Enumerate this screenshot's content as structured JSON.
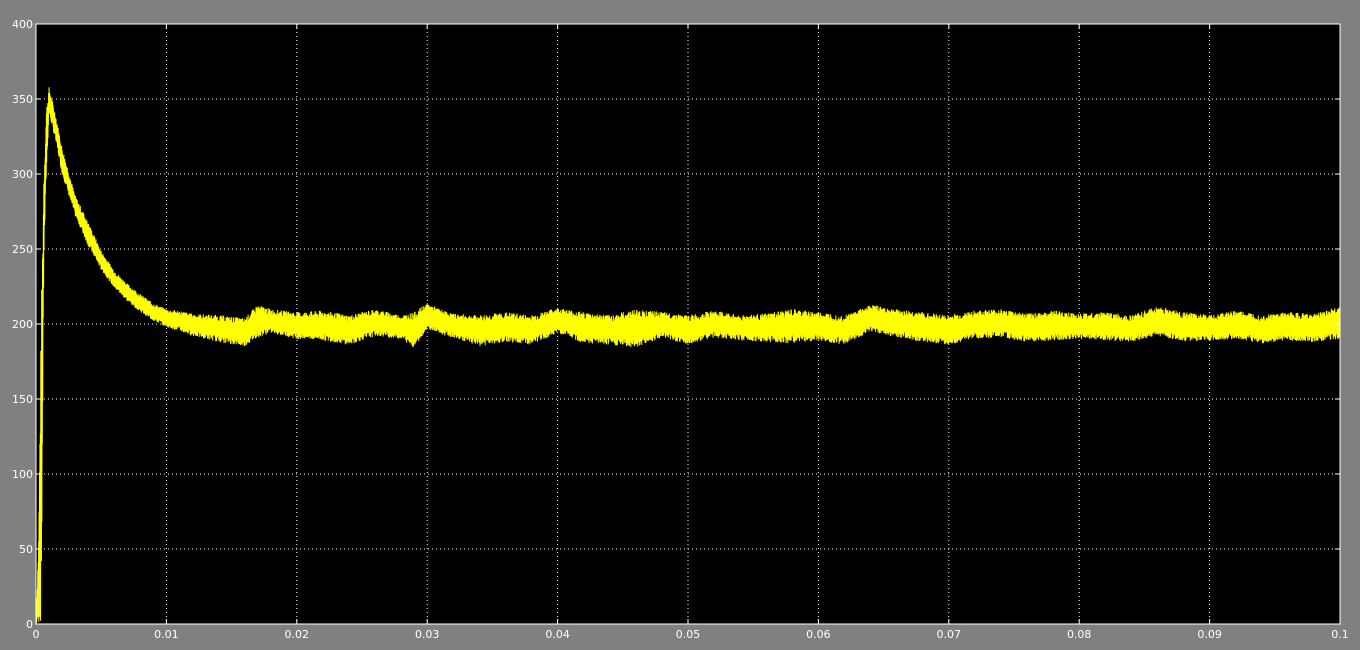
{
  "chart_data": {
    "type": "line",
    "title": "",
    "xlabel": "",
    "ylabel": "",
    "xlim": [
      0,
      0.1
    ],
    "ylim": [
      0,
      400
    ],
    "grid": true,
    "x_ticks": [
      "0",
      "0.01",
      "0.02",
      "0.03",
      "0.04",
      "0.05",
      "0.06",
      "0.07",
      "0.08",
      "0.09",
      "0.1"
    ],
    "y_ticks": [
      "0",
      "50",
      "100",
      "150",
      "200",
      "250",
      "300",
      "350",
      "400"
    ],
    "series": [
      {
        "color": "#ffff00",
        "envelope_x": [
          0,
          0.0002,
          0.0004,
          0.0006,
          0.0008,
          0.001,
          0.0015,
          0.002,
          0.003,
          0.004,
          0.005,
          0.006,
          0.007,
          0.008,
          0.009,
          0.01,
          0.011,
          0.012,
          0.014,
          0.016,
          0.017,
          0.018,
          0.02,
          0.022,
          0.024,
          0.026,
          0.028,
          0.029,
          0.03,
          0.031,
          0.032,
          0.034,
          0.036,
          0.038,
          0.04,
          0.042,
          0.044,
          0.046,
          0.048,
          0.05,
          0.052,
          0.054,
          0.056,
          0.058,
          0.06,
          0.062,
          0.064,
          0.066,
          0.068,
          0.07,
          0.072,
          0.074,
          0.076,
          0.078,
          0.08,
          0.082,
          0.084,
          0.086,
          0.088,
          0.09,
          0.092,
          0.094,
          0.096,
          0.098,
          0.1
        ],
        "upper": [
          0,
          60,
          210,
          300,
          345,
          358,
          340,
          318,
          286,
          268,
          249,
          236,
          227,
          220,
          214,
          210,
          209,
          207,
          206,
          204,
          213,
          210,
          208,
          209,
          206,
          210,
          206,
          208,
          214,
          210,
          207,
          206,
          208,
          206,
          211,
          208,
          206,
          210,
          208,
          206,
          209,
          206,
          207,
          210,
          208,
          206,
          213,
          210,
          208,
          206,
          209,
          210,
          207,
          209,
          207,
          208,
          206,
          212,
          208,
          206,
          209,
          206,
          208,
          207,
          212
        ],
        "lower": [
          0,
          0,
          0,
          240,
          300,
          340,
          322,
          300,
          272,
          252,
          236,
          224,
          215,
          208,
          202,
          198,
          195,
          192,
          188,
          185,
          191,
          194,
          190,
          189,
          186,
          192,
          190,
          184,
          197,
          193,
          191,
          185,
          188,
          186,
          194,
          187,
          186,
          184,
          191,
          186,
          191,
          189,
          188,
          187,
          189,
          186,
          195,
          191,
          188,
          186,
          190,
          191,
          188,
          189,
          190,
          189,
          188,
          192,
          188,
          189,
          190,
          187,
          189,
          188,
          190
        ]
      }
    ]
  }
}
